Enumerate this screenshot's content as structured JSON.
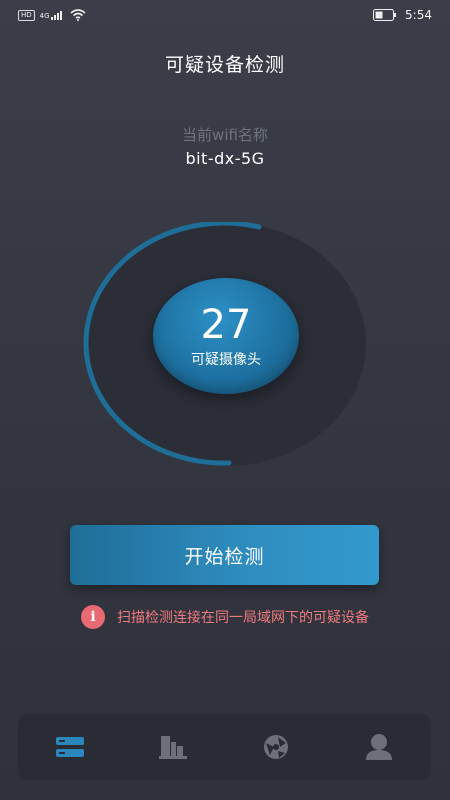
{
  "status_bar": {
    "left_badges": [
      "HD",
      "4G"
    ],
    "time": "5:54"
  },
  "header": {
    "title": "可疑设备检测"
  },
  "wifi": {
    "label": "当前wifi名称",
    "name": "bit-dx-5G"
  },
  "gauge": {
    "count": "27",
    "label": "可疑摄像头"
  },
  "start_button": {
    "label": "开始检测"
  },
  "hint": {
    "icon": "i",
    "text": "扫描检测连接在同一局域网下的可疑设备"
  },
  "colors": {
    "accent": "#2f8cbf",
    "arc": "#1f6e98",
    "warning": "#e96a72",
    "tab_active": "#2a88bd",
    "tab_inactive": "#6d6f79"
  },
  "tabs": [
    {
      "icon": "server-list-icon",
      "active": true
    },
    {
      "icon": "bar-chart-icon",
      "active": false
    },
    {
      "icon": "globe-icon",
      "active": false
    },
    {
      "icon": "user-icon",
      "active": false
    }
  ]
}
